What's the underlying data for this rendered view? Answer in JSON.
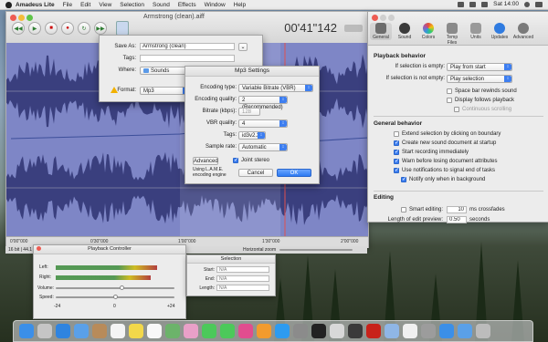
{
  "menubar": {
    "app": "Amadeus Lite",
    "items": [
      "File",
      "Edit",
      "View",
      "Selection",
      "Sound",
      "Effects",
      "Window",
      "Help"
    ],
    "clock": "Sat 14:00"
  },
  "main_window": {
    "title": "Armstrong (clean).aiff",
    "timecode": "00'41\"142",
    "ruler_labels": [
      "0'00\"000",
      "0'30\"000",
      "1'00\"000",
      "1'30\"000",
      "2'00\"000"
    ]
  },
  "save_dialog": {
    "save_as_label": "Save As:",
    "save_as_value": "Armstrong (clean)",
    "tags_label": "Tags:",
    "where_label": "Where:",
    "where_value": "Sounds",
    "format_label": "Format:",
    "format_value": "Mp3"
  },
  "mp3_dialog": {
    "title": "Mp3 Settings",
    "encoding_type_label": "Encoding type:",
    "encoding_type_value": "Variable Bitrate (VBR)",
    "encoding_quality_label": "Encoding quality:",
    "encoding_quality_value": "2 (Recommended)",
    "bitrate_label": "Bitrate (kbps):",
    "bitrate_value": "128",
    "vbr_label": "VBR quality:",
    "vbr_value": "4",
    "tags_label": "Tags:",
    "tags_value": "id3v2.3",
    "sample_rate_label": "Sample rate:",
    "sample_rate_value": "Automatic",
    "advanced_label": "Advanced",
    "joint_stereo_label": "Joint stereo",
    "joint_stereo_checked": true,
    "engine_note_1": "Using L.A.M.E.",
    "engine_note_2": "encoding engine",
    "cancel_label": "Cancel",
    "ok_label": "OK"
  },
  "prefs": {
    "tabs": [
      {
        "label": "General",
        "color": "#6c6c6c"
      },
      {
        "label": "Sound",
        "color": "#3b3b3b"
      },
      {
        "label": "Colors",
        "color": "#d84fa6"
      },
      {
        "label": "Temp Files",
        "color": "#8a8a8a"
      },
      {
        "label": "Units",
        "color": "#9a9a9a"
      },
      {
        "label": "Updates",
        "color": "#2f7be0"
      },
      {
        "label": "Advanced",
        "color": "#7a7a7a"
      }
    ],
    "playback_heading": "Playback behavior",
    "if_empty_label": "If selection is empty:",
    "if_empty_value": "Play from start",
    "if_not_empty_label": "If selection is not empty:",
    "if_not_empty_value": "Play selection",
    "space_rewinds": "Space bar rewinds sound",
    "display_follows": "Display follows playback",
    "continuous_scrolling": "Continuous scrolling",
    "general_heading": "General behavior",
    "general_items": [
      {
        "label": "Extend selection by clicking on boundary",
        "checked": false
      },
      {
        "label": "Create new sound document at startup",
        "checked": true
      },
      {
        "label": "Start recording immediately",
        "checked": true
      },
      {
        "label": "Warn before losing document attributes",
        "checked": true
      },
      {
        "label": "Use notifications to signal end of tasks",
        "checked": true
      },
      {
        "label": "Notify only when in background",
        "checked": true
      }
    ],
    "editing_heading": "Editing",
    "smart_editing_label": "Smart editing:",
    "smart_editing_value": "10",
    "smart_editing_unit": "ms crossfades",
    "preview_label": "Length of edit preview:",
    "preview_value": "0.50",
    "preview_unit": "seconds"
  },
  "controller": {
    "title": "Playback Controller",
    "left_label": "Left:",
    "right_label": "Right:",
    "volume_label": "Volume:",
    "speed_label": "Speed:",
    "scale_low": "-24",
    "scale_mid": "0",
    "scale_high": "+24",
    "volume_level": 0.55,
    "speed_level": 0.5,
    "left_level": 0.85,
    "right_level": 0.8
  },
  "status": {
    "format": "16 bit | 44.1",
    "horizontal_zoom": "Horizontal zoom"
  },
  "selection_win": {
    "title": "Selection",
    "start_label": "Start:",
    "end_label": "End:",
    "length_label": "Length:",
    "placeholder": "N/A"
  },
  "dock": {
    "icons": [
      "finder",
      "launchpad",
      "safari",
      "mail",
      "contacts",
      "calendar",
      "notes",
      "reminders",
      "maps",
      "photos",
      "messages",
      "facetime",
      "itunes",
      "ibooks",
      "appstore",
      "preferences",
      "terminal",
      "activity",
      "amadeus",
      "acrobat",
      "preview",
      "texteditor",
      "keychain",
      "finder2",
      "downloads",
      "trash"
    ]
  }
}
